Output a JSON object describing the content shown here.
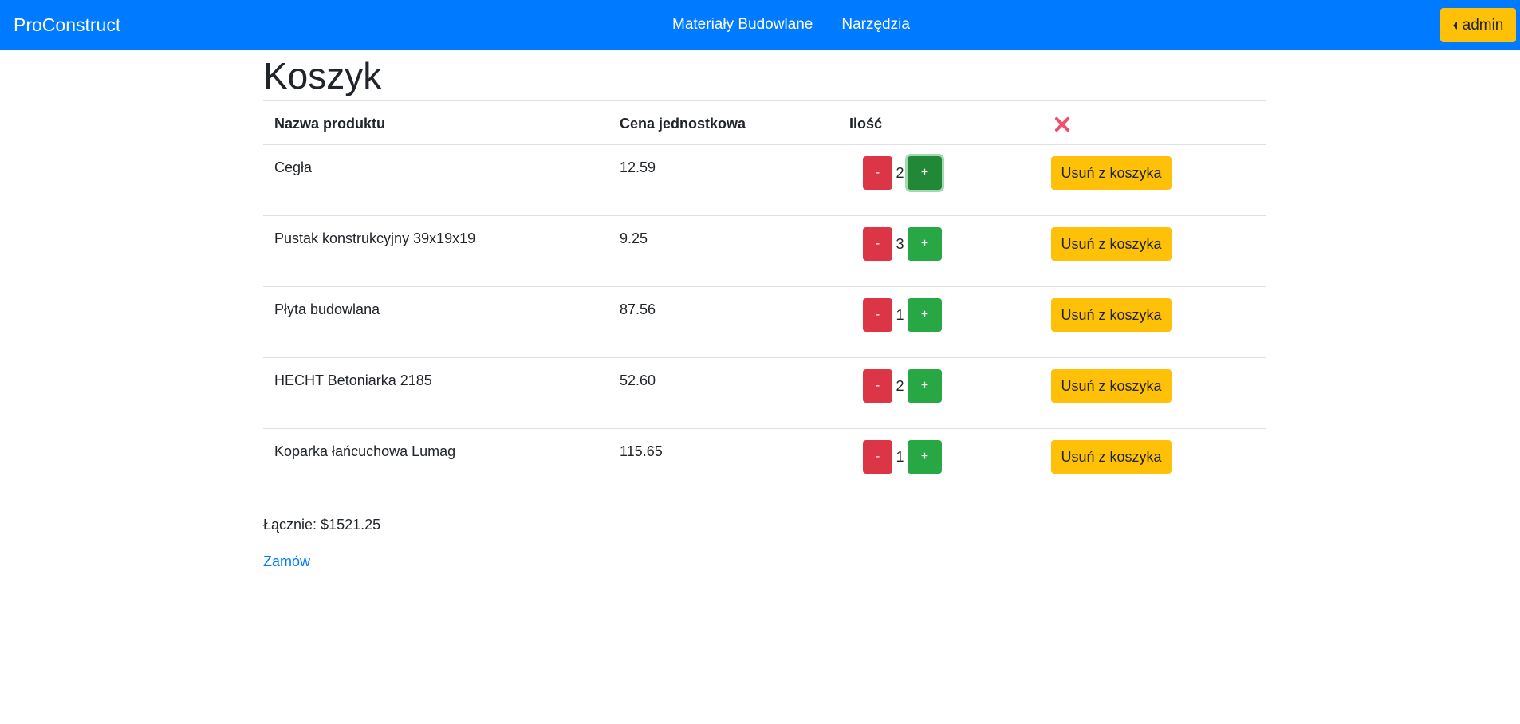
{
  "navbar": {
    "brand": "ProConstruct",
    "links": [
      "Materiały Budowlane",
      "Narzędzia"
    ],
    "user_label": "admin",
    "color": "#007bff"
  },
  "page": {
    "title": "Koszyk"
  },
  "table": {
    "headers": [
      "Nazwa produktu",
      "Cena jednostkowa",
      "Ilość"
    ],
    "clear_icon": "x-icon",
    "rows": [
      {
        "name": "Cegła",
        "price": "12.59",
        "qty": "2",
        "minus": "-",
        "plus": "+",
        "remove": "Usuń z koszyka"
      },
      {
        "name": "Pustak konstrukcyjny 39x19x19",
        "price": "9.25",
        "qty": "3",
        "minus": "-",
        "plus": "+",
        "remove": "Usuń z koszyka"
      },
      {
        "name": "Płyta budowlana",
        "price": "87.56",
        "qty": "1",
        "minus": "-",
        "plus": "+",
        "remove": "Usuń z koszyka"
      },
      {
        "name": "HECHT Betoniarka 2185",
        "price": "52.60",
        "qty": "2",
        "minus": "-",
        "plus": "+",
        "remove": "Usuń z koszyka"
      },
      {
        "name": "Koparka łańcuchowa Lumag",
        "price": "115.65",
        "qty": "1",
        "minus": "-",
        "plus": "+",
        "remove": "Usuń z koszyka"
      }
    ]
  },
  "summary": {
    "total": "Łącznie: $1521.25",
    "order_link": "Zamów"
  },
  "colors": {
    "primary": "#007bff",
    "warning": "#ffc107",
    "danger": "#dc3545",
    "success": "#28a745"
  }
}
